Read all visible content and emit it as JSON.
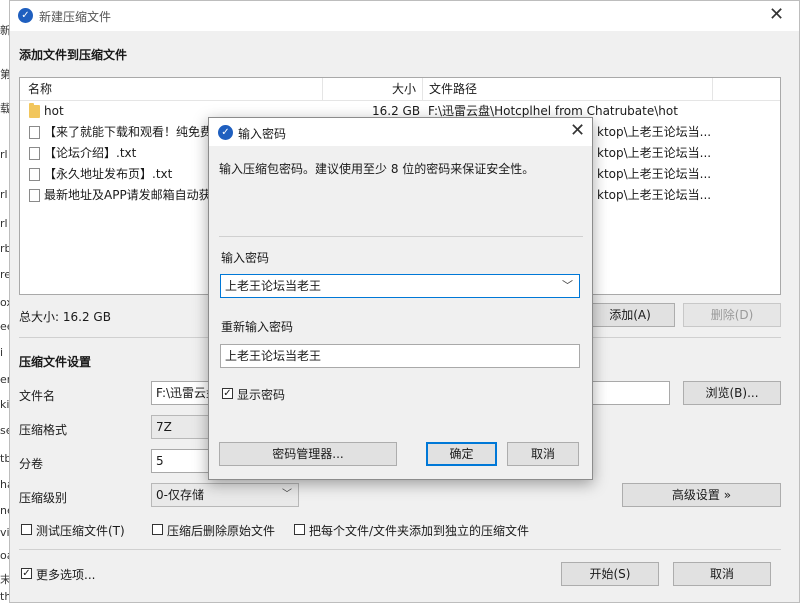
{
  "window": {
    "title": "新建压缩文件"
  },
  "background_strip": [
    "新",
    "第",
    "载",
    "rl",
    "rl",
    "rl",
    "rb",
    "re",
    "ox",
    "ee",
    "i",
    "er",
    "ki",
    "se",
    "tb",
    "ha",
    "ne",
    "vi",
    "oa",
    "末",
    "three"
  ],
  "add_section": {
    "title": "添加文件到压缩文件"
  },
  "file_list": {
    "headers": {
      "name": "名称",
      "size": "大小",
      "path": "文件路径"
    },
    "rows": [
      {
        "icon": "folder-icon",
        "name": "hot",
        "size": "16.2 GB",
        "path": "F:\\迅雷云盘\\Hotcplhel from Chatrubate\\hot"
      },
      {
        "icon": "document-icon",
        "name": "【来了就能下载和观看！纯免费",
        "size": "",
        "path": "ktop\\上老王论坛当..."
      },
      {
        "icon": "document-icon",
        "name": "【论坛介绍】.txt",
        "size": "",
        "path": "ktop\\上老王论坛当..."
      },
      {
        "icon": "document-icon",
        "name": "【永久地址发布页】.txt",
        "size": "",
        "path": "ktop\\上老王论坛当..."
      },
      {
        "icon": "document-icon",
        "name": "最新地址及APP请发邮箱自动获",
        "size": "",
        "path": "ktop\\上老王论坛当..."
      }
    ]
  },
  "total_size": "总大小: 16.2 GB",
  "buttons": {
    "add": "添加(A)",
    "delete": "删除(D)",
    "browse": "浏览(B)...",
    "advanced": "高级设置 »",
    "start": "开始(S)",
    "cancel": "取消"
  },
  "settings": {
    "title": "压缩文件设置",
    "filename_label": "文件名",
    "filename_value": "F:\\迅雷云盘",
    "format_label": "压缩格式",
    "format_value": "7Z",
    "volume_label": "分卷",
    "volume_value": "5",
    "level_label": "压缩级别",
    "level_value": "0-仅存储"
  },
  "options": {
    "test": {
      "label": "测试压缩文件(T)",
      "checked": false
    },
    "delete_after": {
      "label": "压缩后删除原始文件",
      "checked": false
    },
    "each_separate": {
      "label": "把每个文件/文件夹添加到独立的压缩文件",
      "checked": false
    },
    "more": {
      "label": "更多选项...",
      "checked": true
    }
  },
  "dialog": {
    "title": "输入密码",
    "description": "输入压缩包密码。建议使用至少 8 位的密码来保证安全性。",
    "password_label": "输入密码",
    "password_value": "上老王论坛当老王",
    "confirm_label": "重新输入密码",
    "confirm_value": "上老王论坛当老王",
    "show_password": {
      "label": "显示密码",
      "checked": true
    },
    "manager_button": "密码管理器...",
    "ok_button": "确定",
    "cancel_button": "取消"
  },
  "colors": {
    "accent": "#0078d7",
    "app_icon": "#1f5fbf",
    "folder": "#f2c65c"
  }
}
